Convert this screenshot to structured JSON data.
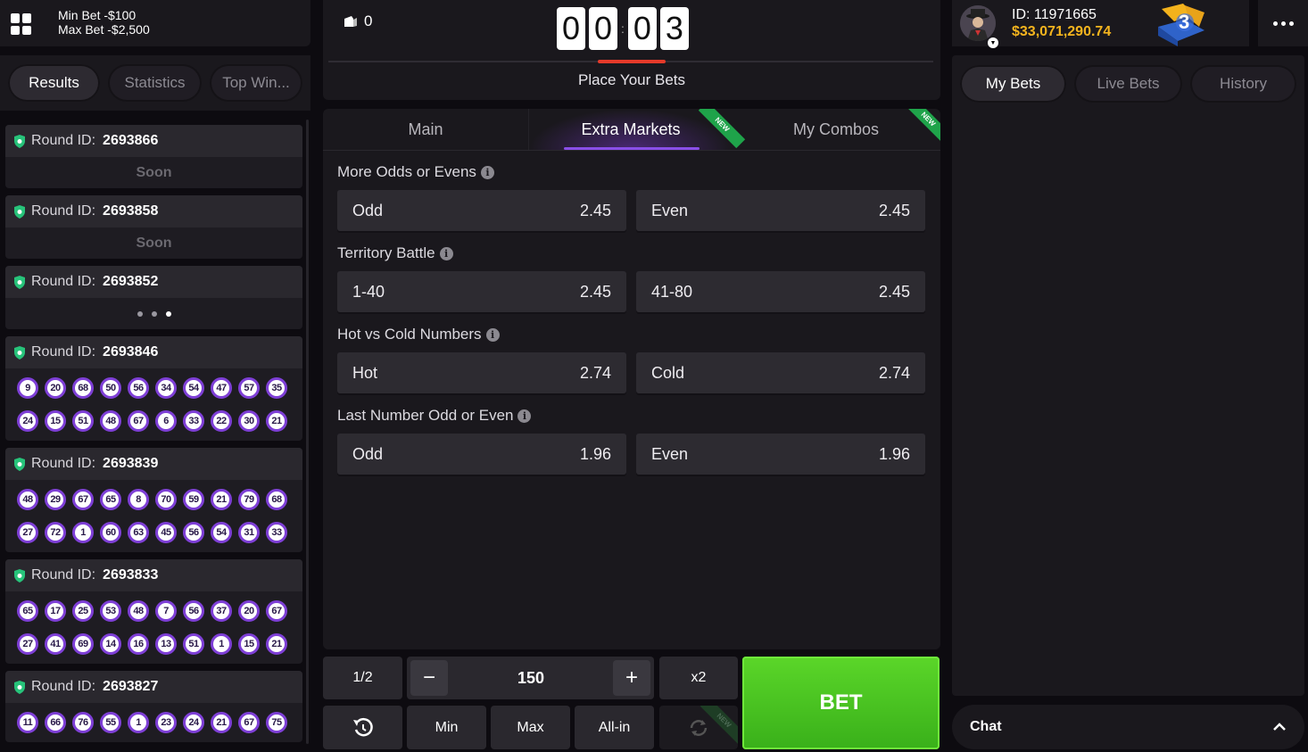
{
  "header_left": {
    "min_bet": "Min Bet -$100",
    "max_bet": "Max Bet -$2,500"
  },
  "left_tabs": [
    "Results",
    "Statistics",
    "Top Win..."
  ],
  "results": {
    "round_label": "Round ID:",
    "soon_label": "Soon",
    "rounds": [
      {
        "id": "2693866",
        "state": "soon"
      },
      {
        "id": "2693858",
        "state": "soon"
      },
      {
        "id": "2693852",
        "state": "drawing"
      },
      {
        "id": "2693846",
        "state": "done",
        "balls": [
          [
            "9",
            "20",
            "68",
            "50",
            "56",
            "34",
            "54",
            "47",
            "57",
            "35"
          ],
          [
            "24",
            "15",
            "51",
            "48",
            "67",
            "6",
            "33",
            "22",
            "30",
            "21"
          ]
        ]
      },
      {
        "id": "2693839",
        "state": "done",
        "balls": [
          [
            "48",
            "29",
            "67",
            "65",
            "8",
            "70",
            "59",
            "21",
            "79",
            "68"
          ],
          [
            "27",
            "72",
            "1",
            "60",
            "63",
            "45",
            "56",
            "54",
            "31",
            "33"
          ]
        ]
      },
      {
        "id": "2693833",
        "state": "done",
        "balls": [
          [
            "65",
            "17",
            "25",
            "53",
            "48",
            "7",
            "56",
            "37",
            "20",
            "67"
          ],
          [
            "27",
            "41",
            "69",
            "14",
            "16",
            "13",
            "51",
            "1",
            "15",
            "21"
          ]
        ]
      },
      {
        "id": "2693827",
        "state": "done",
        "balls": [
          [
            "11",
            "66",
            "76",
            "55",
            "1",
            "23",
            "24",
            "21",
            "67",
            "75"
          ]
        ]
      }
    ]
  },
  "timer": {
    "players_count": "0",
    "digits": [
      "0",
      "0",
      "0",
      "3"
    ],
    "status": "Place Your Bets"
  },
  "market_tabs": [
    {
      "label": "Main",
      "new": false
    },
    {
      "label": "Extra Markets",
      "new": true
    },
    {
      "label": "My Combos",
      "new": true
    }
  ],
  "new_tag": "NEW",
  "markets": [
    {
      "title": "More Odds or Evens",
      "options": [
        {
          "label": "Odd",
          "odds": "2.45"
        },
        {
          "label": "Even",
          "odds": "2.45"
        }
      ]
    },
    {
      "title": "Territory Battle",
      "options": [
        {
          "label": "1-40",
          "odds": "2.45"
        },
        {
          "label": "41-80",
          "odds": "2.45"
        }
      ]
    },
    {
      "title": "Hot vs Cold Numbers",
      "options": [
        {
          "label": "Hot",
          "odds": "2.74"
        },
        {
          "label": "Cold",
          "odds": "2.74"
        }
      ]
    },
    {
      "title": "Last Number Odd or Even",
      "options": [
        {
          "label": "Odd",
          "odds": "1.96"
        },
        {
          "label": "Even",
          "odds": "1.96"
        }
      ]
    }
  ],
  "bet_controls": {
    "half": "1/2",
    "minus": "−",
    "amount": "150",
    "plus": "+",
    "double": "x2",
    "min": "Min",
    "max": "Max",
    "allin": "All-in",
    "bet": "BET"
  },
  "user": {
    "id": "ID: 11971665",
    "balance": "$33,071,290.74",
    "prize_badge": "3"
  },
  "right_tabs": [
    "My Bets",
    "Live Bets",
    "History"
  ],
  "chat": {
    "label": "Chat"
  },
  "colors": {
    "accent_green": "#3fbf1f",
    "balance_gold": "#f5b51e",
    "ball_ring": "#7e3fd6",
    "timer_bar": "#e53a2a"
  }
}
